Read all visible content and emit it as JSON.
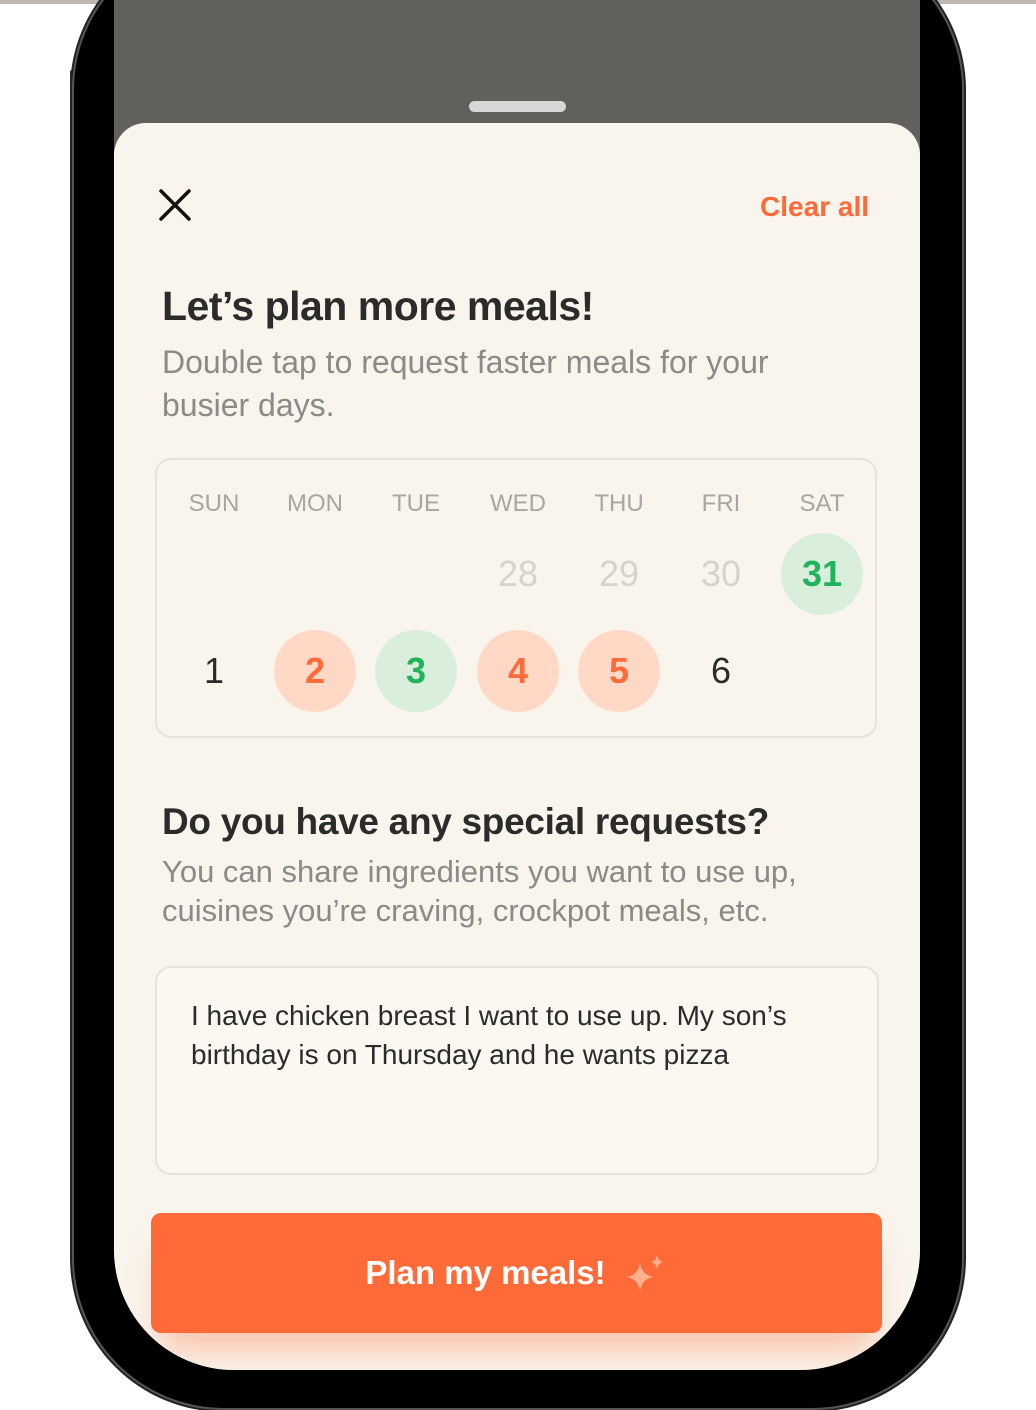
{
  "header": {
    "close_icon": "close-icon",
    "clear_label": "Clear all"
  },
  "plan": {
    "title": "Let’s plan more meals!",
    "subtitle_line1": "Double tap to request faster meals for your",
    "subtitle_line2": "busier days."
  },
  "calendar": {
    "weekdays": [
      "SUN",
      "MON",
      "TUE",
      "WED",
      "THU",
      "FRI",
      "SAT"
    ],
    "week1": [
      {
        "day": "28",
        "state": "past"
      },
      {
        "day": "29",
        "state": "past"
      },
      {
        "day": "30",
        "state": "past"
      },
      {
        "day": "31",
        "state": "green"
      }
    ],
    "week2": [
      {
        "day": "1",
        "state": "plain"
      },
      {
        "day": "2",
        "state": "orange"
      },
      {
        "day": "3",
        "state": "green"
      },
      {
        "day": "4",
        "state": "orange"
      },
      {
        "day": "5",
        "state": "orange"
      },
      {
        "day": "6",
        "state": "plain"
      }
    ]
  },
  "requests": {
    "title": "Do you have any special requests?",
    "subtitle_line1": "You can share ingredients you want to use up,",
    "subtitle_line2": "cuisines you’re craving, crockpot meals, etc.",
    "value_line1": "I have chicken breast I want to use up. My son’s",
    "value_line2": "birthday is on Thursday and he wants pizza"
  },
  "cta": {
    "label": "Plan my meals!",
    "icon": "sparkle-icon"
  },
  "colors": {
    "accent": "#ff6a39",
    "green": "#1fb35c",
    "background": "#f9f5ec"
  }
}
